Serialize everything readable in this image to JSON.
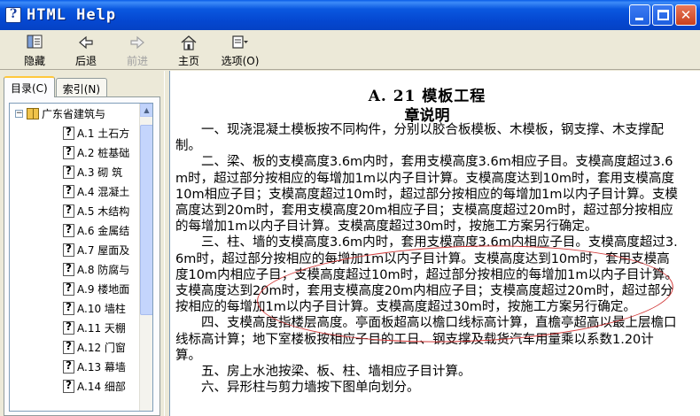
{
  "window": {
    "title": "HTML Help"
  },
  "toolbar": {
    "hide_label": "隐藏",
    "back_label": "后退",
    "forward_label": "前进",
    "home_label": "主页",
    "options_label": "选项(O)"
  },
  "leftpane": {
    "tabs": [
      {
        "label": "目录(C)"
      },
      {
        "label": "索引(N)"
      }
    ],
    "tree": {
      "root_label": "广东省建筑与",
      "items": [
        {
          "label": "A.1  土石方"
        },
        {
          "label": "A.2  桩基础"
        },
        {
          "label": "A.3  砌  筑"
        },
        {
          "label": "A.4  混凝土"
        },
        {
          "label": "A.5  木结构"
        },
        {
          "label": "A.6  金属结"
        },
        {
          "label": "A.7  屋面及"
        },
        {
          "label": "A.8  防腐与"
        },
        {
          "label": "A.9  楼地面"
        },
        {
          "label": "A.10  墙柱"
        },
        {
          "label": "A.11  天棚"
        },
        {
          "label": "A.12  门窗"
        },
        {
          "label": "A.13  幕墙"
        },
        {
          "label": "A.14  细部"
        }
      ]
    }
  },
  "content": {
    "title": "A. 21   模板工程",
    "subtitle": "章说明",
    "paragraphs": [
      "一、现浇混凝土模板按不同构件，分别以胶合板模板、木模板，钢支撑、木支撑配制。",
      "二、梁、板的支模高度3.6m内时，套用支模高度3.6m相应子目。支模高度超过3.6m时，超过部分按相应的每增加1m以内子目计算。支模高度达到10m时，套用支模高度10m相应子目；支模高度超过10m时，超过部分按相应的每增加1m以内子目计算。支模高度达到20m时，套用支模高度20m相应子目；支模高度超过20m时，超过部分按相应的每增加1m以内子目计算。支模高度超过30m时，按施工方案另行确定。",
      "三、柱、墙的支模高度3.6m内时，套用支模高度3.6m内相应子目。支模高度超过3.6m时，超过部分按相应的每增加1m以内子目计算。支模高度达到10m时，套用支模高度10m内相应子目；支模高度超过10m时，超过部分按相应的每增加1m以内子目计算。支模高度达到20m时，套用支模高度20m内相应子目；支模高度超过20m时，超过部分按相应的每增加1m以内子目计算。支模高度超过30m时，按施工方案另行确定。",
      "四、支模高度指楼层高度。亭面板超高以檐口线标高计算，直檐亭超高以最上层檐口线标高计算；地下室楼板按相应子目的工日、钢支撑及载货汽车用量乘以系数1.20计算。",
      "五、房上水池按梁、板、柱、墙相应子目计算。",
      "六、异形柱与剪力墙按下图单向划分。"
    ]
  },
  "colors": {
    "titlebar": "#0547d0",
    "annotation_ellipse": "#d23b3b"
  }
}
